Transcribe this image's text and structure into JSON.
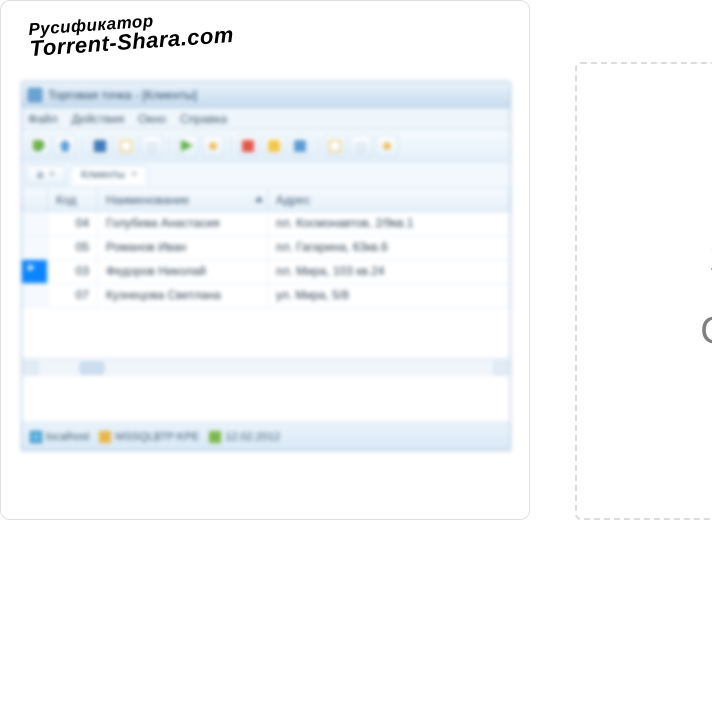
{
  "watermark": {
    "line1": "Русификатор",
    "line2": "Torrent-Shara.com"
  },
  "window": {
    "title": "Торговая точка - [Клиенты]",
    "menus": [
      "Файл",
      "Действия",
      "Окно",
      "Справка"
    ],
    "tabs": {
      "tab_a": "а",
      "tab_b": "Клиенты",
      "close": "×"
    },
    "grid": {
      "headers": {
        "code": "Код",
        "name": "Наименование",
        "addr": "Адрес"
      },
      "rows": [
        {
          "code": "04",
          "name": "Голубева Анастасия",
          "addr": "пл. Космонавтов, 2/9кв.1"
        },
        {
          "code": "05",
          "name": "Романов Иван",
          "addr": "пл. Гагарина, 63кв.6"
        },
        {
          "code": "03",
          "name": "Федоров Николай",
          "addr": "пл. Мира, 103 кв.24"
        },
        {
          "code": "07",
          "name": "Кузнецова Светлана",
          "addr": "ул. Мира, 5/8"
        }
      ]
    },
    "status": {
      "host": "localhost",
      "db": "MSSQL$TP:KPE",
      "date": "12.02.2012"
    }
  },
  "right_card": {
    "top": "З",
    "bottom": "СК"
  }
}
